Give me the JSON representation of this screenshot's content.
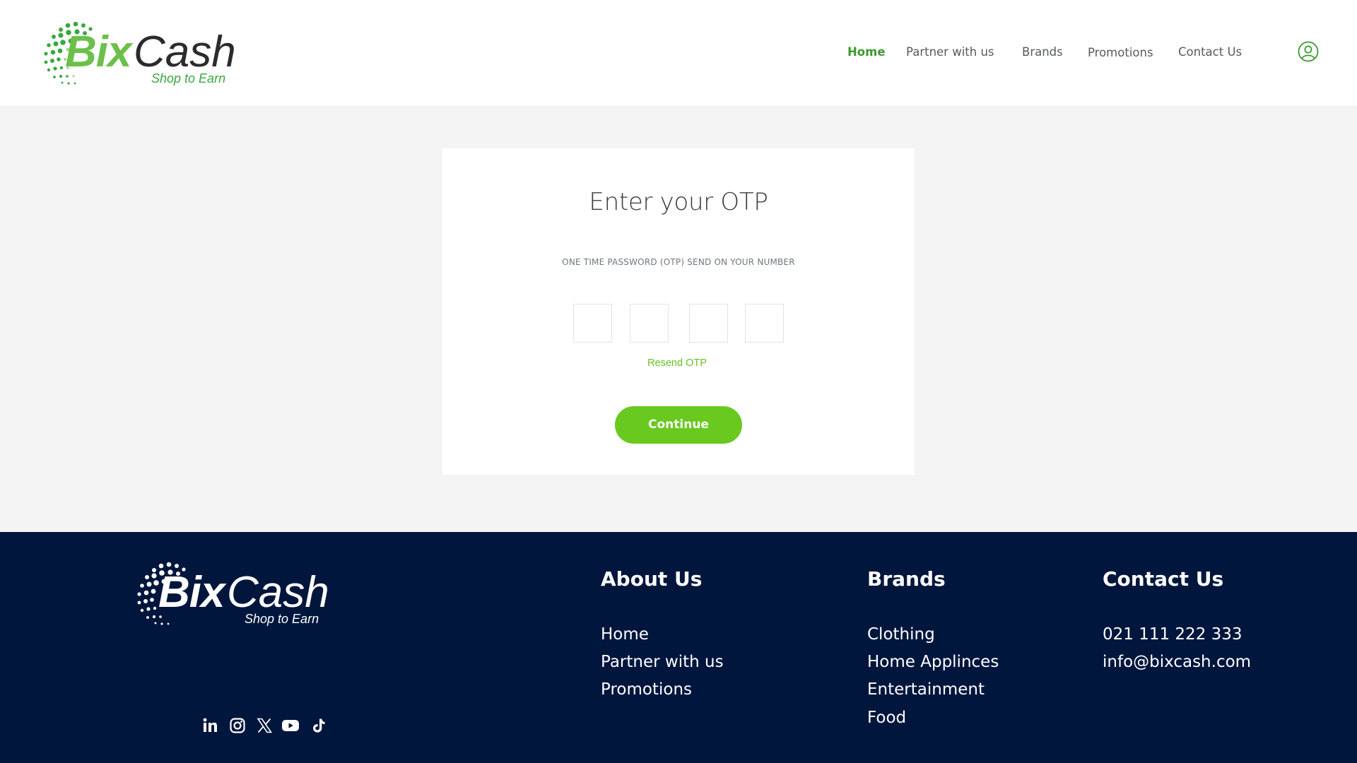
{
  "brand": {
    "name_part1": "Bix",
    "name_part2": "Cash",
    "tagline": "Shop to Earn",
    "green": "#6cc04a",
    "navy": "#00163d"
  },
  "nav": {
    "items": [
      {
        "label": "Home",
        "active": true
      },
      {
        "label": "Partner with us",
        "active": false
      },
      {
        "label": "Brands",
        "active": false
      },
      {
        "label": "Promotions",
        "active": false
      },
      {
        "label": "Contact Us",
        "active": false
      }
    ],
    "account_icon": "user-circle-icon"
  },
  "otp": {
    "title": "Enter your OTP",
    "subtitle": "ONE TIME PASSWORD (OTP) SEND ON YOUR NUMBER",
    "digits": [
      "",
      "",
      "",
      ""
    ],
    "resend_label": "Resend OTP",
    "continue_label": "Continue",
    "button_color": "#69c91f"
  },
  "footer": {
    "about": {
      "title": "About Us",
      "links": [
        "Home",
        "Partner with us",
        "Promotions"
      ]
    },
    "brands": {
      "title": "Brands",
      "links": [
        "Clothing",
        "Home Applinces",
        "Entertainment",
        "Food"
      ]
    },
    "contact": {
      "title": "Contact Us",
      "phone": "021 111 222 333",
      "email": "info@bixcash.com"
    },
    "social": [
      "linkedin-icon",
      "instagram-icon",
      "x-icon",
      "youtube-icon",
      "tiktok-icon"
    ]
  }
}
